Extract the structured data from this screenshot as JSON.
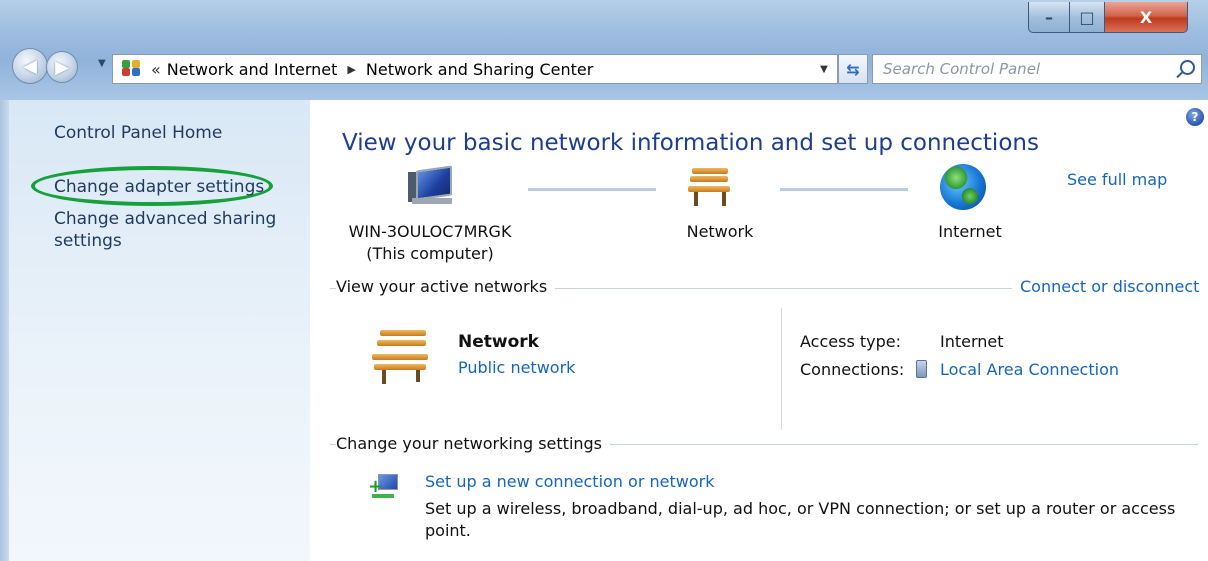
{
  "window": {
    "minimize_glyph": "–",
    "maximize_glyph": "□",
    "close_glyph": "X"
  },
  "address_bar": {
    "chevron": "«",
    "breadcrumbs": [
      "Network and Internet",
      "Network and Sharing Center"
    ],
    "separator": "▶",
    "dropdown_glyph": "▼",
    "refresh_glyph": "⇆"
  },
  "search": {
    "placeholder": "Search Control Panel",
    "value": ""
  },
  "sidebar": {
    "items": [
      {
        "label": "Control Panel Home"
      },
      {
        "label": "Change adapter settings",
        "highlighted": true,
        "highlight_color": "#15a23c"
      },
      {
        "label": "Change advanced sharing settings"
      }
    ]
  },
  "main": {
    "help_glyph": "?",
    "title": "View your basic network information and set up connections",
    "see_full_map": "See full map",
    "map": {
      "computer": {
        "name": "WIN-3OULOC7MRGK",
        "sub": "(This computer)"
      },
      "network": {
        "name": "Network"
      },
      "internet": {
        "name": "Internet"
      }
    },
    "active_networks": {
      "header": "View your active networks",
      "action": "Connect or disconnect",
      "network_name": "Network",
      "network_type": "Public network",
      "access_type_label": "Access type:",
      "access_type_value": "Internet",
      "connections_label": "Connections:",
      "connections_value": "Local Area Connection"
    },
    "networking_settings": {
      "header": "Change your networking settings",
      "tasks": [
        {
          "link": "Set up a new connection or network",
          "description": "Set up a wireless, broadband, dial-up, ad hoc, or VPN connection; or set up a router or access point."
        }
      ]
    }
  },
  "colors": {
    "link": "#1565c0",
    "title": "#1e3d8f",
    "sidebar_text": "#1e3a5f",
    "highlight": "#15a23c"
  }
}
